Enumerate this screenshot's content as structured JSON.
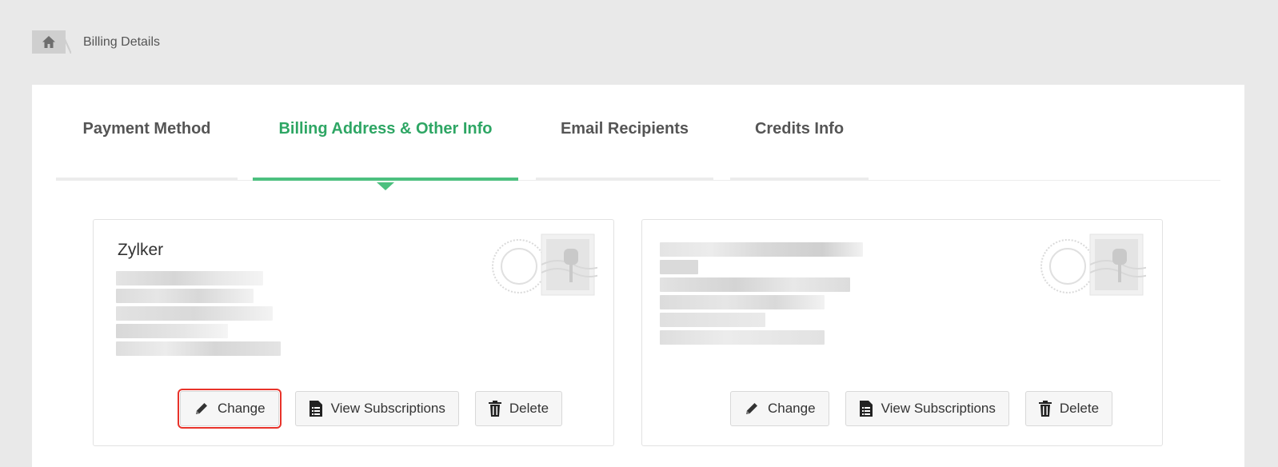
{
  "breadcrumb": {
    "home_icon": "home-icon",
    "current": "Billing Details"
  },
  "tabs": [
    {
      "label": "Payment Method",
      "active": false
    },
    {
      "label": "Billing Address & Other Info",
      "active": true
    },
    {
      "label": "Email Recipients",
      "active": false
    },
    {
      "label": "Credits Info",
      "active": false
    }
  ],
  "cards": [
    {
      "name": "Zylker",
      "buttons": {
        "change": "Change",
        "view_subscriptions": "View Subscriptions",
        "delete": "Delete"
      },
      "change_highlighted": true
    },
    {
      "name": "",
      "buttons": {
        "change": "Change",
        "view_subscriptions": "View Subscriptions",
        "delete": "Delete"
      },
      "change_highlighted": false
    }
  ],
  "colors": {
    "accent": "#2ea664",
    "highlight": "#e8332a"
  }
}
